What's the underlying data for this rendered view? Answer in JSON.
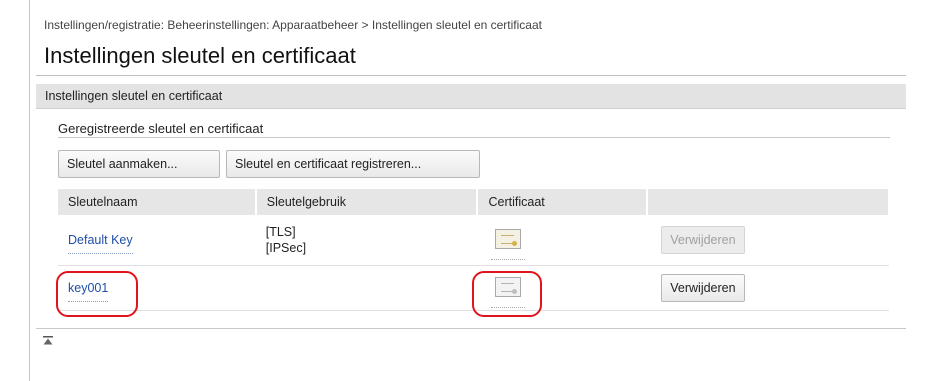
{
  "breadcrumb": "Instellingen/registratie: Beheerinstellingen: Apparaatbeheer > Instellingen sleutel en certificaat",
  "page": {
    "title": "Instellingen sleutel en certificaat"
  },
  "section": {
    "title": "Instellingen sleutel en certificaat"
  },
  "registered": {
    "title": "Geregistreerde sleutel en certificaat",
    "buttons": {
      "create": "Sleutel aanmaken...",
      "register": "Sleutel en certificaat registreren..."
    }
  },
  "table": {
    "headers": [
      "Sleutelnaam",
      "Sleutelgebruik",
      "Certificaat",
      ""
    ],
    "rows": [
      {
        "key_name": "Default Key",
        "usage": [
          "[TLS]",
          "[IPSec]"
        ],
        "certificate_icon": "certificate-icon",
        "delete_label": "Verwijderen",
        "delete_enabled": false
      },
      {
        "key_name": "key001",
        "usage": [],
        "certificate_icon": "certificate-icon",
        "delete_label": "Verwijderen",
        "delete_enabled": true
      }
    ]
  },
  "colors": {
    "link": "#1f4fa8",
    "highlight": "#e0141c",
    "section_bar": "#e3e3e3",
    "header_bg": "#e6e6e6"
  },
  "icons": {
    "back_to_top": "back-to-top-icon"
  }
}
